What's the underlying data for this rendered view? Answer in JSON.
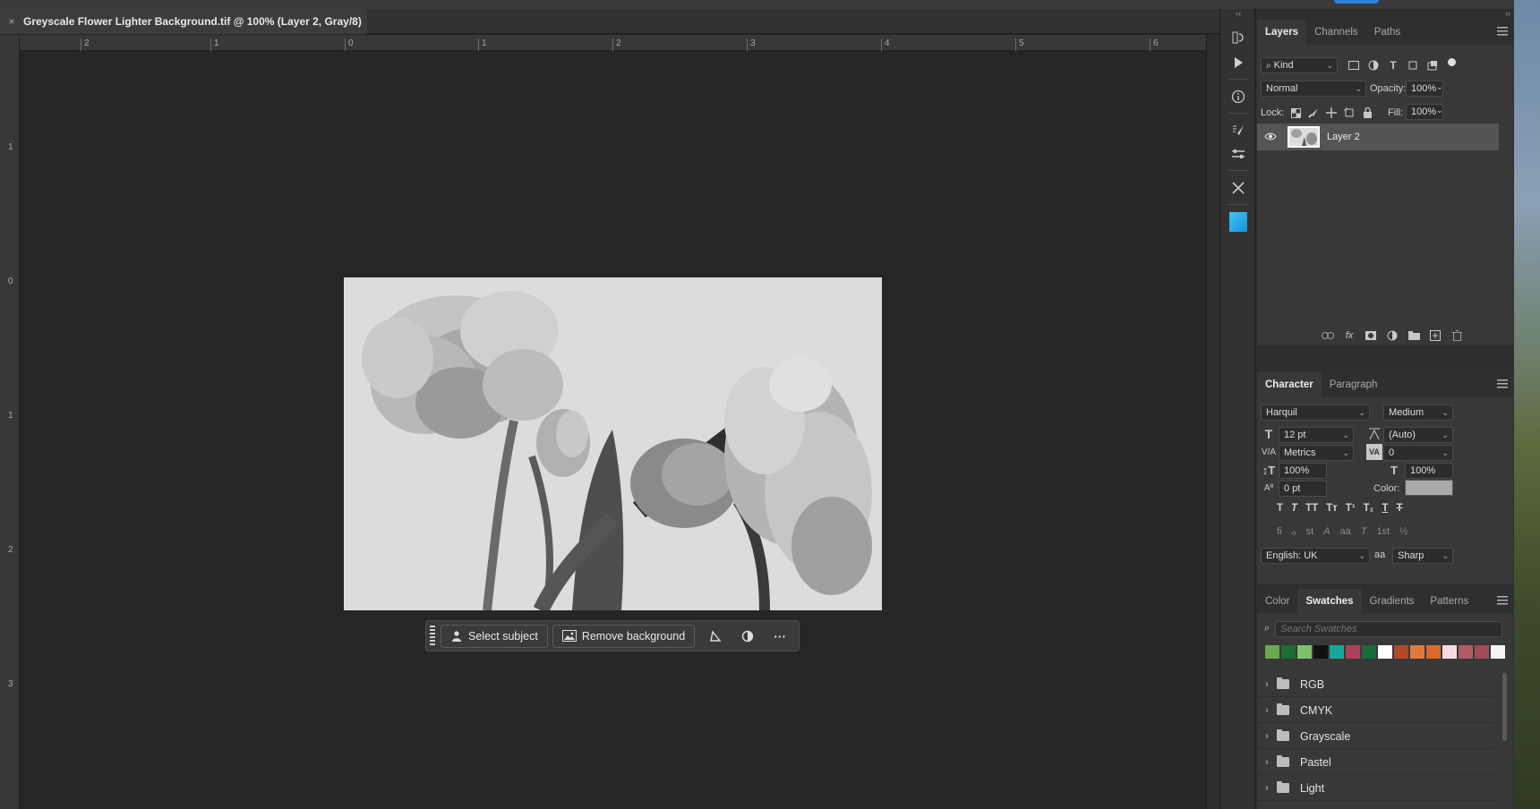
{
  "document": {
    "tab_close": "×",
    "tab_title": "Greyscale Flower Lighter Background.tif @ 100% (Layer 2, Gray/8)"
  },
  "rulers": {
    "top_ticks": [
      "2",
      "1",
      "0",
      "1",
      "2",
      "3",
      "4",
      "5",
      "6"
    ],
    "left_ticks": [
      "1",
      "0",
      "1",
      "2",
      "3"
    ]
  },
  "taskbar": {
    "select_subject": "Select subject",
    "remove_background": "Remove background",
    "more": "···"
  },
  "layers_panel": {
    "tabs": [
      "Layers",
      "Channels",
      "Paths"
    ],
    "filter_kind": "Kind",
    "blend_mode": "Normal",
    "opacity_label": "Opacity:",
    "opacity_value": "100%",
    "lock_label": "Lock:",
    "fill_label": "Fill:",
    "fill_value": "100%",
    "layers": [
      {
        "name": "Layer 2",
        "visible": true
      }
    ]
  },
  "character_panel": {
    "tabs": [
      "Character",
      "Paragraph"
    ],
    "font_family": "Harquil",
    "font_style": "Medium",
    "font_size": "12 pt",
    "leading": "(Auto)",
    "kerning": "Metrics",
    "tracking": "0",
    "vertical_scale": "100%",
    "horizontal_scale": "100%",
    "baseline_shift": "0 pt",
    "color_label": "Color:",
    "language": "English: UK",
    "antialias_icon": "aa",
    "antialias": "Sharp"
  },
  "swatches_panel": {
    "tabs": [
      "Color",
      "Swatches",
      "Gradients",
      "Patterns"
    ],
    "search_placeholder": "Search Swatches",
    "colors": [
      "#6aa84f",
      "#1e6b3a",
      "#7cc36b",
      "#111111",
      "#1aa79a",
      "#b0405a",
      "#1a6a3a",
      "#ffffff",
      "#b04a2a",
      "#e07a3a",
      "#d96a2a",
      "#f7d9e3",
      "#b05a6a",
      "#a04a5a",
      "#f4f4f4"
    ],
    "groups": [
      "RGB",
      "CMYK",
      "Grayscale",
      "Pastel",
      "Light"
    ]
  },
  "colors": {
    "app_bg": "#262626",
    "panel_bg": "#383838",
    "accent_cyan": "#3fc6f0"
  }
}
